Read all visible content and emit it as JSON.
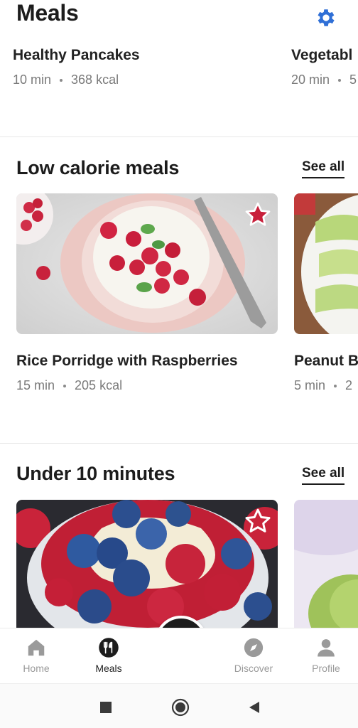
{
  "header": {
    "title": "Meals",
    "settings_icon": "gear-icon"
  },
  "top_row": {
    "cards": [
      {
        "name": "Healthy Pancakes",
        "time": "10 min",
        "kcal": "368 kcal"
      },
      {
        "name": "Vegetabl",
        "time": "20 min",
        "kcal": "5"
      }
    ]
  },
  "low_calorie": {
    "title": "Low calorie meals",
    "see_all": "See all",
    "cards": [
      {
        "name": "Rice Porridge with Raspberries",
        "time": "15 min",
        "kcal": "205 kcal",
        "favorite": true
      },
      {
        "name": "Peanut B",
        "time": "5 min",
        "kcal": "2"
      }
    ]
  },
  "under_10": {
    "title": "Under 10 minutes",
    "see_all": "See all",
    "cards": [
      {
        "favorite": false
      },
      {}
    ]
  },
  "bottom_nav": {
    "items": [
      {
        "label": "Home",
        "icon": "home-icon",
        "active": false
      },
      {
        "label": "Meals",
        "icon": "cutlery-icon",
        "active": true
      },
      {
        "label": "Discover",
        "icon": "compass-icon",
        "active": false
      },
      {
        "label": "Profile",
        "icon": "person-icon",
        "active": false
      }
    ],
    "add_icon": "plus-icon"
  },
  "colors": {
    "accent": "#2f6fd6",
    "favorite": "#c8203b",
    "dark": "#1d1d1d"
  }
}
